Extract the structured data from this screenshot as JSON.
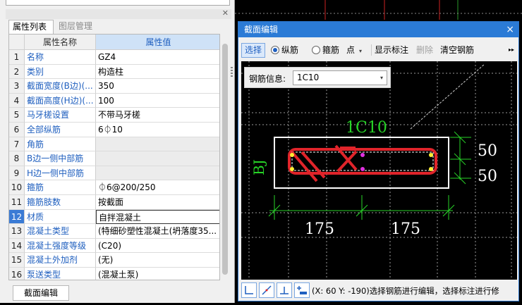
{
  "left_panel": {
    "tabs": [
      "属性列表",
      "图层管理"
    ],
    "header": {
      "name": "属性名称",
      "value": "属性值"
    },
    "rows": [
      {
        "num": "1",
        "name": "名称",
        "value": "GZ4"
      },
      {
        "num": "2",
        "name": "类别",
        "value": "构造柱"
      },
      {
        "num": "3",
        "name": "截面宽度(B边)(...",
        "value": "350"
      },
      {
        "num": "4",
        "name": "截面高度(H边)(...",
        "value": "100"
      },
      {
        "num": "5",
        "name": "马牙槎设置",
        "value": "不带马牙槎"
      },
      {
        "num": "6",
        "name": "全部纵筋",
        "value": "6⏀10"
      },
      {
        "num": "7",
        "name": "角筋",
        "value": ""
      },
      {
        "num": "8",
        "name": "B边一侧中部筋",
        "value": ""
      },
      {
        "num": "9",
        "name": "H边一侧中部筋",
        "value": ""
      },
      {
        "num": "10",
        "name": "箍筋",
        "value": "⏀6@200/250"
      },
      {
        "num": "11",
        "name": "箍筋肢数",
        "value": "按截面"
      },
      {
        "num": "12",
        "name": "材质",
        "value": "自拌混凝土"
      },
      {
        "num": "13",
        "name": "混凝土类型",
        "value": "(特细砂塑性混凝土(坍落度35..."
      },
      {
        "num": "14",
        "name": "混凝土强度等级",
        "value": "(C20)"
      },
      {
        "num": "15",
        "name": "混凝土外加剂",
        "value": "(无)"
      },
      {
        "num": "16",
        "name": "泵送类型",
        "value": "(混凝土泵)"
      }
    ],
    "bottom_tab": "截面编辑"
  },
  "dialog": {
    "title": "截面编辑",
    "close": "×",
    "toolbar": {
      "select": "选择",
      "longitudinal": "纵筋",
      "stirrup": "箍筋",
      "mode": "点",
      "show_label": "显示标注",
      "delete": "删除",
      "clear": "清空钢筋",
      "more": "▸▸"
    },
    "rebar_info_label": "钢筋信息:",
    "rebar_info_value": "1C10",
    "canvas": {
      "top_label": "1C10",
      "side_label": "BJ",
      "dim_right_1": "50",
      "dim_right_2": "50",
      "dim_bottom_1": "175",
      "dim_bottom_2": "175"
    },
    "status": "(X: 60 Y: -190)选择钢筋进行编辑，选择标注进行修"
  },
  "colors": {
    "accent": "#2b7bd6",
    "rebar_red": "#e0242a",
    "label_green": "#27d327"
  }
}
